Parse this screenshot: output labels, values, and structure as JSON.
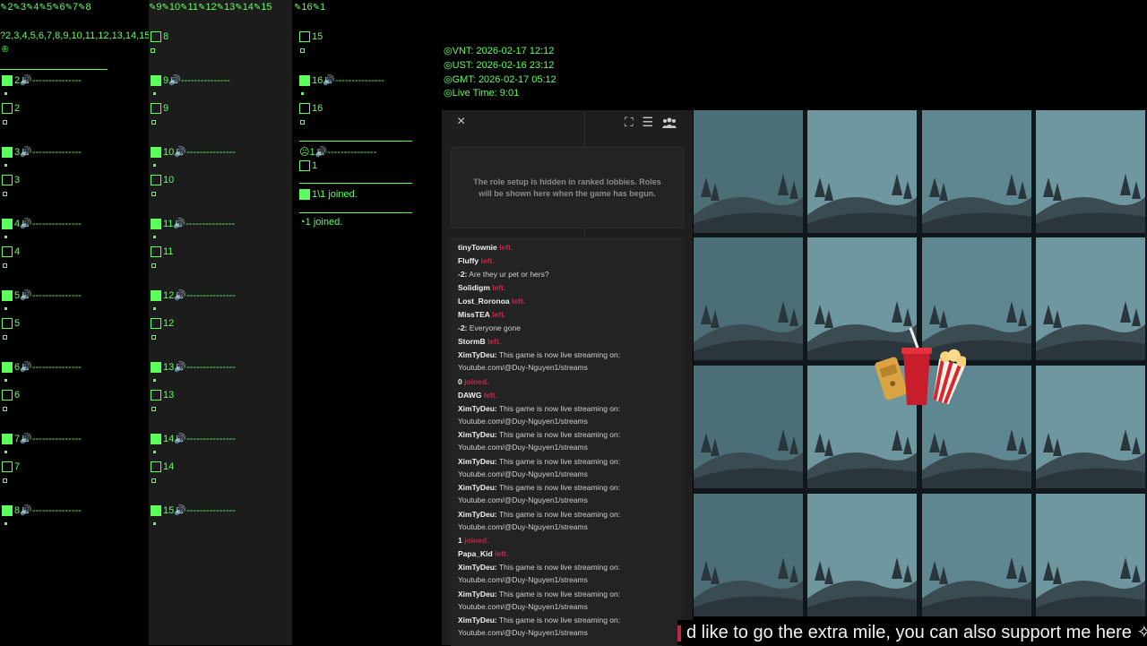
{
  "tabs_col1": [
    "2",
    "3",
    "4",
    "5",
    "6",
    "7",
    "8"
  ],
  "tabs_col2": [
    "9",
    "10",
    "11",
    "12",
    "13",
    "14",
    "15"
  ],
  "tabs_col3": [
    "16",
    "1"
  ],
  "seat_list": "2,3,4,5,6,7,8,9,10,11,12,13,14,15,16",
  "col1_rows": [
    {
      "num": "2",
      "dashes": "---------------",
      "seat": "2"
    },
    {
      "num": "3",
      "dashes": "---------------",
      "seat": "3"
    },
    {
      "num": "4",
      "dashes": "---------------",
      "seat": "4"
    },
    {
      "num": "5",
      "dashes": "---------------",
      "seat": "5"
    },
    {
      "num": "6",
      "dashes": "---------------",
      "seat": "6"
    },
    {
      "num": "7",
      "dashes": "---------------",
      "seat": "7"
    },
    {
      "num": "8",
      "dashes": "---------------",
      "seat": ""
    }
  ],
  "col2_top": "8",
  "col2_rows": [
    {
      "num": "9",
      "dashes": "---------------",
      "seat": "9"
    },
    {
      "num": "10",
      "dashes": "---------------",
      "seat": "10"
    },
    {
      "num": "11",
      "dashes": "---------------",
      "seat": "11"
    },
    {
      "num": "12",
      "dashes": "---------------",
      "seat": "12"
    },
    {
      "num": "13",
      "dashes": "---------------",
      "seat": "13"
    },
    {
      "num": "14",
      "dashes": "---------------",
      "seat": "14"
    },
    {
      "num": "15",
      "dashes": "---------------",
      "seat": ""
    }
  ],
  "col3_top": "15",
  "col3_row16": {
    "num": "16",
    "dashes": "---------------",
    "seat": "16"
  },
  "col3_row1": {
    "num": "1",
    "dashes": "---------------",
    "seat": "1"
  },
  "col3_joined_a": "1\\1 joined.",
  "col3_joined_b": "1 joined.",
  "clocks": {
    "vnt": "VNT: 2026-02-17 12:12",
    "ust": "UST: 2026-02-16 23:12",
    "gmt": "GMT: 2026-02-17 05:12",
    "live": "Live Time: 9:01"
  },
  "panel": {
    "close_icon": "×",
    "roles_text": "The role setup is hidden in ranked lobbies. Roles will be shown here when the game has begun."
  },
  "chat": [
    {
      "name": "tinyTownie",
      "text": "",
      "tag": "left."
    },
    {
      "name": "Fluffy",
      "text": "",
      "tag": "left."
    },
    {
      "name": "-2:",
      "text": " Are they ur pet or hers?",
      "tag": ""
    },
    {
      "name": "Solidigm",
      "text": "",
      "tag": "left."
    },
    {
      "name": "Lost_Roronoa",
      "text": "",
      "tag": "left."
    },
    {
      "name": "MissTEA",
      "text": "",
      "tag": "left."
    },
    {
      "name": "-2:",
      "text": " Everyone gone",
      "tag": ""
    },
    {
      "name": "StormB",
      "text": "",
      "tag": "left."
    },
    {
      "name": "XimTyDeu:",
      "text": " This game is now live streaming on:",
      "tag": "",
      "line2": "Youtube.com/@Duy-Nguyen1/streams"
    },
    {
      "name": "0",
      "text": "",
      "tag": "joined."
    },
    {
      "name": "DAWG",
      "text": "",
      "tag": "left."
    },
    {
      "name": "XimTyDeu:",
      "text": " This game is now live streaming on:",
      "tag": "",
      "line2": "Youtube.com/@Duy-Nguyen1/streams"
    },
    {
      "name": "XimTyDeu:",
      "text": " This game is now live streaming on:",
      "tag": "",
      "line2": "Youtube.com/@Duy-Nguyen1/streams"
    },
    {
      "name": "XimTyDeu:",
      "text": " This game is now live streaming on:",
      "tag": "",
      "line2": "Youtube.com/@Duy-Nguyen1/streams"
    },
    {
      "name": "XimTyDeu:",
      "text": " This game is now live streaming on:",
      "tag": "",
      "line2": "Youtube.com/@Duy-Nguyen1/streams"
    },
    {
      "name": "XimTyDeu:",
      "text": " This game is now live streaming on:",
      "tag": "",
      "line2": "Youtube.com/@Duy-Nguyen1/streams"
    },
    {
      "name": "1",
      "text": "",
      "tag": "joined."
    },
    {
      "name": "Papa_Kid",
      "text": "",
      "tag": "left."
    },
    {
      "name": "XimTyDeu:",
      "text": " This game is now live streaming on:",
      "tag": "",
      "line2": "Youtube.com/@Duy-Nguyen1/streams"
    },
    {
      "name": "XimTyDeu:",
      "text": " This game is now live streaming on:",
      "tag": "",
      "line2": "Youtube.com/@Duy-Nguyen1/streams"
    },
    {
      "name": "XimTyDeu:",
      "text": " This game is now live streaming on:",
      "tag": "",
      "line2": "Youtube.com/@Duy-Nguyen1/streams"
    }
  ],
  "ticker": "d like to go the extra mile, you can also support me here",
  "colors": {
    "accent_green": "#5cff5c",
    "left_red": "#c0284a",
    "tile": "#6f97a0"
  },
  "icons": {
    "close": "close-icon",
    "fullscreen": "fullscreen-icon",
    "menu": "menu-icon",
    "players": "players-icon",
    "event": "popcorn-cinema-icon"
  }
}
